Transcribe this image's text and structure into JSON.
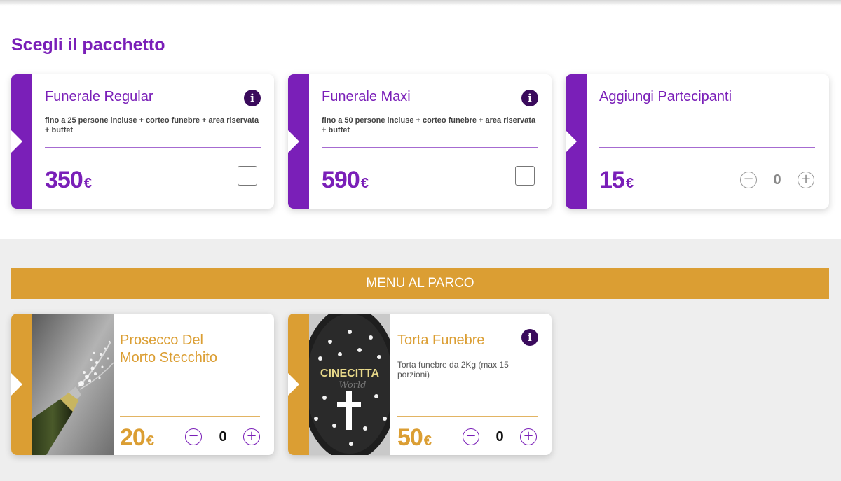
{
  "section_title": "Scegli il pacchetto",
  "packages": [
    {
      "title": "Funerale Regular",
      "description": "fino a 25 persone incluse + corteo funebre + area riservata + buffet",
      "price": "350",
      "currency": "€",
      "control": "checkbox",
      "checked": false
    },
    {
      "title": "Funerale Maxi",
      "description": "fino a 50 persone incluse + corteo funebre + area riservata + buffet",
      "price": "590",
      "currency": "€",
      "control": "checkbox",
      "checked": false
    },
    {
      "title": "Aggiungi Partecipanti",
      "price": "15",
      "currency": "€",
      "control": "stepper",
      "quantity": "0"
    }
  ],
  "menu_banner": "MENU AL PARCO",
  "menu_items": [
    {
      "title_line1": "Prosecco Del",
      "title_line2": "Morto Stecchito",
      "image": "champagne-bottle-image",
      "price": "20",
      "currency": "€",
      "quantity": "0"
    },
    {
      "title_line1": "Torta Funebre",
      "description": "Torta funebre da 2Kg (max 15 porzioni)",
      "image": "black-cake-image",
      "image_text_1": "CINECITTA",
      "image_text_2": "World",
      "price": "50",
      "currency": "€",
      "quantity": "0"
    }
  ],
  "icons": {
    "info": "info-icon",
    "minus": "minus-circle-icon",
    "plus": "plus-circle-icon",
    "minus_glyph": "−",
    "plus_glyph": "+",
    "info_glyph": "i"
  },
  "colors": {
    "purple": "#7a1fb8",
    "gold": "#db9e33",
    "info_bg": "#3a0a5c"
  }
}
